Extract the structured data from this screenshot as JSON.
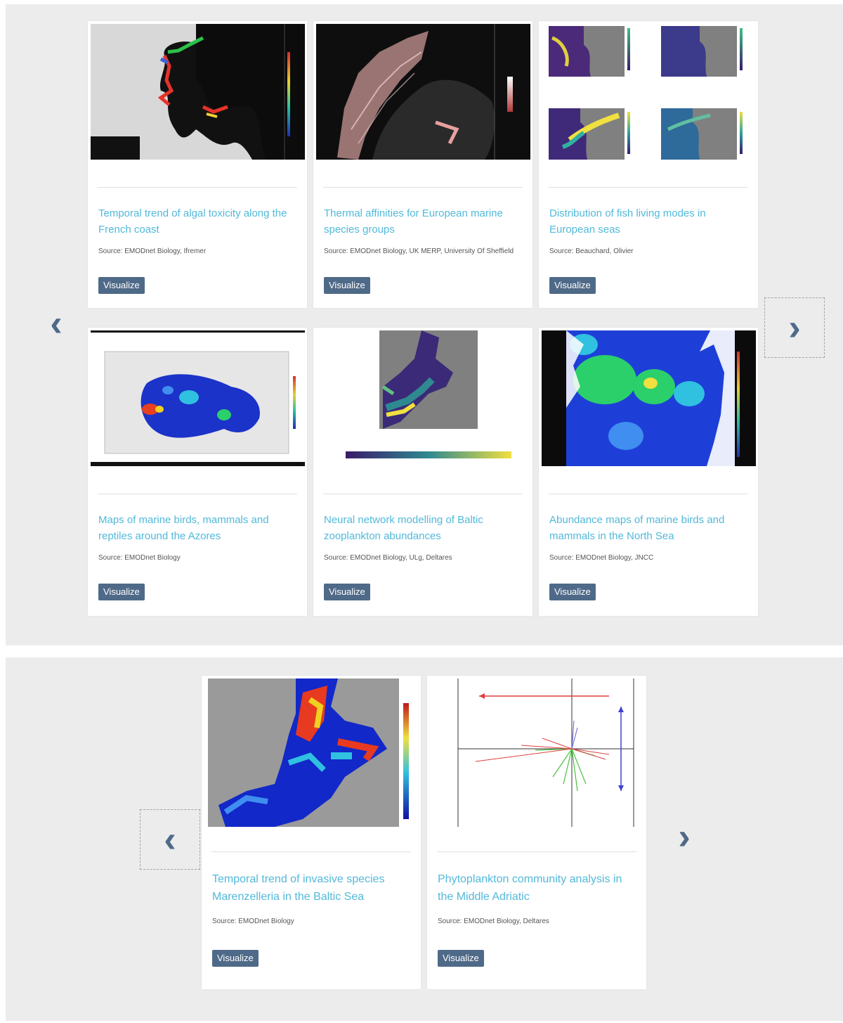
{
  "carousel_1": {
    "prev_icon": "‹",
    "next_icon": "›",
    "cards": [
      {
        "title": "Temporal trend of algal toxicity along the French coast",
        "source": "Source: EMODnet Biology, Ifremer",
        "button": "Visualize"
      },
      {
        "title": "Thermal affinities for European marine species groups",
        "source": "Source: EMODnet Biology, UK MERP, University Of Sheffield",
        "button": "Visualize"
      },
      {
        "title": "Distribution of fish living modes in European seas",
        "source": "Source: Beauchard, Olivier",
        "button": "Visualize"
      },
      {
        "title": "Maps of marine birds, mammals and reptiles around the Azores",
        "source": "Source: EMODnet Biology",
        "button": "Visualize"
      },
      {
        "title": "Neural network modelling of Baltic zooplankton abundances",
        "source": "Source: EMODnet Biology, ULg, Deltares",
        "button": "Visualize"
      },
      {
        "title": "Abundance maps of marine birds and mammals in the North Sea",
        "source": "Source: EMODnet Biology, JNCC",
        "button": "Visualize"
      }
    ]
  },
  "carousel_2": {
    "prev_icon": "‹",
    "next_icon": "›",
    "cards": [
      {
        "title": "Temporal trend of invasive species Marenzelleria in the Baltic Sea",
        "source": "Source: EMODnet Biology",
        "button": "Visualize"
      },
      {
        "title": "Phytoplankton community analysis in the Middle Adriatic",
        "source": "Source: EMODnet Biology, Deltares",
        "button": "Visualize"
      }
    ]
  },
  "colors": {
    "accent_title": "#52b9d9",
    "button_bg": "#4f6a88",
    "panel_bg": "#ececec"
  }
}
